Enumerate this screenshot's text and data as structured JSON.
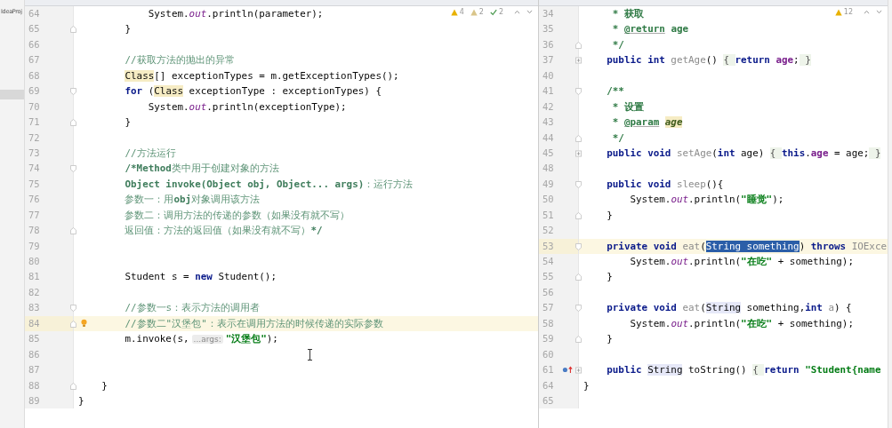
{
  "sidebar": {
    "label": "IdeaProj"
  },
  "panes": [
    {
      "inspections": [
        {
          "kind": "warning",
          "count": "4"
        },
        {
          "kind": "weak",
          "count": "2"
        },
        {
          "kind": "typo",
          "count": "2"
        }
      ],
      "lines": [
        {
          "number": "64",
          "current": false,
          "tokens": [
            {
              "t": "            System.",
              "kind": "plain"
            },
            {
              "t": "out",
              "kind": "field"
            },
            {
              "t": ".println(parameter);",
              "kind": "plain"
            }
          ]
        },
        {
          "number": "65",
          "current": false,
          "fold_end": true,
          "tokens": [
            {
              "t": "        }",
              "kind": "plain"
            }
          ]
        },
        {
          "number": "66",
          "current": false
        },
        {
          "number": "67",
          "current": false,
          "tokens": [
            {
              "t": "        //获取方法的抛出的异常",
              "kind": "cmt"
            }
          ]
        },
        {
          "number": "68",
          "current": false,
          "tokens": [
            {
              "t": "        Class",
              "kind": "hl"
            },
            {
              "t": "[] exceptionTypes = m.getExceptionTypes();",
              "kind": "plain"
            }
          ]
        },
        {
          "number": "69",
          "current": false,
          "fold_start": true,
          "tokens": [
            {
              "t": "        for",
              "kind": "kw"
            },
            {
              "t": " (",
              "kind": "plain"
            },
            {
              "t": "Class",
              "kind": "hl"
            },
            {
              "t": " exceptionType : exceptionTypes) {",
              "kind": "plain"
            }
          ]
        },
        {
          "number": "70",
          "current": false,
          "tokens": [
            {
              "t": "            System.",
              "kind": "plain"
            },
            {
              "t": "out",
              "kind": "field"
            },
            {
              "t": ".println(exceptionType);",
              "kind": "plain"
            }
          ]
        },
        {
          "number": "71",
          "current": false,
          "fold_end": true,
          "tokens": [
            {
              "t": "        }",
              "kind": "plain"
            }
          ]
        },
        {
          "number": "72",
          "current": false
        },
        {
          "number": "73",
          "current": false,
          "tokens": [
            {
              "t": "        //方法运行",
              "kind": "cmt"
            }
          ]
        },
        {
          "number": "74",
          "current": false,
          "fold_start": true,
          "tokens": [
            {
              "t": "        /*Method",
              "kind": "cmtb"
            },
            {
              "t": "类中用于创建对象的方法",
              "kind": "cmt"
            }
          ]
        },
        {
          "number": "75",
          "current": false,
          "tokens": [
            {
              "t": "        Object invoke(Object obj, Object... args)",
              "kind": "cmtb"
            },
            {
              "t": "：运行方法",
              "kind": "cmt"
            }
          ]
        },
        {
          "number": "76",
          "current": false,
          "tokens": [
            {
              "t": "        参数一：用",
              "kind": "cmt"
            },
            {
              "t": "obj",
              "kind": "cmtb"
            },
            {
              "t": "对象调用该方法",
              "kind": "cmt"
            }
          ]
        },
        {
          "number": "77",
          "current": false,
          "tokens": [
            {
              "t": "        参数二：调用方法的传递的参数（如果没有就不写）",
              "kind": "cmt"
            }
          ]
        },
        {
          "number": "78",
          "current": false,
          "fold_end": true,
          "tokens": [
            {
              "t": "        返回值：方法的返回值（如果没有就不写）",
              "kind": "cmt"
            },
            {
              "t": "*/",
              "kind": "cmtb"
            }
          ]
        },
        {
          "number": "79",
          "current": false
        },
        {
          "number": "80",
          "current": false
        },
        {
          "number": "81",
          "current": false,
          "tokens": [
            {
              "t": "        Student s = ",
              "kind": "plain"
            },
            {
              "t": "new",
              "kind": "kw"
            },
            {
              "t": " Student();",
              "kind": "plain"
            }
          ]
        },
        {
          "number": "82",
          "current": false
        },
        {
          "number": "83",
          "current": false,
          "fold_start": true,
          "tokens": [
            {
              "t": "        //参数一s：表示方法的调用者",
              "kind": "cmt"
            }
          ]
        },
        {
          "number": "84",
          "current": true,
          "fold_end": true,
          "bulb": true,
          "tokens": [
            {
              "t": "        //参数二\"汉堡包\"：表示在调用方法的时候传递的实际参数",
              "kind": "cmt"
            }
          ]
        },
        {
          "number": "85",
          "current": false,
          "tokens": [
            {
              "t": "        m.invoke(s,",
              "kind": "plain"
            },
            {
              "t": "...args:",
              "kind": "hint"
            },
            {
              "t": "\"汉堡包\"",
              "kind": "str"
            },
            {
              "t": ");",
              "kind": "plain"
            }
          ]
        },
        {
          "number": "86",
          "current": false
        },
        {
          "number": "87",
          "current": false
        },
        {
          "number": "88",
          "current": false,
          "fold_end": true,
          "tokens": [
            {
              "t": "    }",
              "kind": "plain"
            }
          ]
        },
        {
          "number": "89",
          "current": false,
          "tokens": [
            {
              "t": "}",
              "kind": "plain"
            }
          ]
        }
      ]
    },
    {
      "inspections": [
        {
          "kind": "warning",
          "count": "12"
        }
      ],
      "lines": [
        {
          "number": "34",
          "current": false,
          "tokens": [
            {
              "t": "     * 获取",
              "kind": "doc"
            }
          ]
        },
        {
          "number": "35",
          "current": false,
          "tokens": [
            {
              "t": "     * ",
              "kind": "doc"
            },
            {
              "t": "@return",
              "kind": "tag"
            },
            {
              "t": " age",
              "kind": "doc"
            }
          ]
        },
        {
          "number": "36",
          "current": false,
          "fold_end": true,
          "tokens": [
            {
              "t": "     */",
              "kind": "doc"
            }
          ]
        },
        {
          "number": "37",
          "current": false,
          "collapsed": true,
          "tokens": [
            {
              "t": "    public int ",
              "kind": "kw"
            },
            {
              "t": "getAge",
              "kind": "dim"
            },
            {
              "t": "() ",
              "kind": "plain"
            },
            {
              "t": "{ ",
              "kind": "folded"
            },
            {
              "t": "return ",
              "kind": "kw"
            },
            {
              "t": "age",
              "kind": "ivar"
            },
            {
              "t": ";",
              "kind": "plain"
            },
            {
              "t": " }",
              "kind": "folded"
            }
          ]
        },
        {
          "number": "40",
          "current": false
        },
        {
          "number": "41",
          "current": false,
          "fold_start": true,
          "tokens": [
            {
              "t": "    /**",
              "kind": "doc"
            }
          ]
        },
        {
          "number": "42",
          "current": false,
          "tokens": [
            {
              "t": "     * 设置",
              "kind": "doc"
            }
          ]
        },
        {
          "number": "43",
          "current": false,
          "tokens": [
            {
              "t": "     * ",
              "kind": "doc"
            },
            {
              "t": "@param",
              "kind": "tag"
            },
            {
              "t": "age",
              "kind": "param"
            }
          ]
        },
        {
          "number": "44",
          "current": false,
          "fold_end": true,
          "tokens": [
            {
              "t": "     */",
              "kind": "doc"
            }
          ]
        },
        {
          "number": "45",
          "current": false,
          "collapsed": true,
          "tokens": [
            {
              "t": "    public void ",
              "kind": "kw"
            },
            {
              "t": "setAge",
              "kind": "dim"
            },
            {
              "t": "(",
              "kind": "plain"
            },
            {
              "t": "int",
              "kind": "kw"
            },
            {
              "t": " age) ",
              "kind": "plain"
            },
            {
              "t": "{ ",
              "kind": "folded"
            },
            {
              "t": "this",
              "kind": "kw"
            },
            {
              "t": ".",
              "kind": "plain"
            },
            {
              "t": "age",
              "kind": "ivar"
            },
            {
              "t": " = age;",
              "kind": "plain"
            },
            {
              "t": " }",
              "kind": "folded"
            }
          ]
        },
        {
          "number": "48",
          "current": false
        },
        {
          "number": "49",
          "current": false,
          "fold_start": true,
          "tokens": [
            {
              "t": "    public void ",
              "kind": "kw"
            },
            {
              "t": "sleep",
              "kind": "dim"
            },
            {
              "t": "(){",
              "kind": "plain"
            }
          ]
        },
        {
          "number": "50",
          "current": false,
          "tokens": [
            {
              "t": "        System.",
              "kind": "plain"
            },
            {
              "t": "out",
              "kind": "field"
            },
            {
              "t": ".println(",
              "kind": "plain"
            },
            {
              "t": "\"睡觉\"",
              "kind": "str"
            },
            {
              "t": ");",
              "kind": "plain"
            }
          ]
        },
        {
          "number": "51",
          "current": false,
          "fold_end": true,
          "tokens": [
            {
              "t": "    }",
              "kind": "plain"
            }
          ]
        },
        {
          "number": "52",
          "current": false
        },
        {
          "number": "53",
          "current": true,
          "fold_start": true,
          "tokens": [
            {
              "t": "    private void ",
              "kind": "kw"
            },
            {
              "t": "eat",
              "kind": "dim"
            },
            {
              "t": "(",
              "kind": "plain"
            },
            {
              "t": "String something",
              "kind": "sel"
            },
            {
              "t": ") ",
              "kind": "plain"
            },
            {
              "t": "throws ",
              "kind": "kw"
            },
            {
              "t": "IOExce",
              "kind": "dim"
            }
          ]
        },
        {
          "number": "54",
          "current": false,
          "tokens": [
            {
              "t": "        System.",
              "kind": "plain"
            },
            {
              "t": "out",
              "kind": "field"
            },
            {
              "t": ".println(",
              "kind": "plain"
            },
            {
              "t": "\"在吃\"",
              "kind": "str"
            },
            {
              "t": " + something);",
              "kind": "plain"
            }
          ]
        },
        {
          "number": "55",
          "current": false,
          "fold_end": true,
          "tokens": [
            {
              "t": "    }",
              "kind": "plain"
            }
          ]
        },
        {
          "number": "56",
          "current": false
        },
        {
          "number": "57",
          "current": false,
          "fold_start": true,
          "tokens": [
            {
              "t": "    private void ",
              "kind": "kw"
            },
            {
              "t": "eat",
              "kind": "dim"
            },
            {
              "t": "(",
              "kind": "plain"
            },
            {
              "t": "String",
              "kind": "ref"
            },
            {
              "t": " something,",
              "kind": "plain"
            },
            {
              "t": "int ",
              "kind": "kw"
            },
            {
              "t": "a",
              "kind": "dim"
            },
            {
              "t": ") {",
              "kind": "plain"
            }
          ]
        },
        {
          "number": "58",
          "current": false,
          "tokens": [
            {
              "t": "        System.",
              "kind": "plain"
            },
            {
              "t": "out",
              "kind": "field"
            },
            {
              "t": ".println(",
              "kind": "plain"
            },
            {
              "t": "\"在吃\"",
              "kind": "str"
            },
            {
              "t": " + something);",
              "kind": "plain"
            }
          ]
        },
        {
          "number": "59",
          "current": false,
          "fold_end": true,
          "tokens": [
            {
              "t": "    }",
              "kind": "plain"
            }
          ]
        },
        {
          "number": "60",
          "current": false
        },
        {
          "number": "61",
          "current": false,
          "collapsed": true,
          "override": true,
          "tokens": [
            {
              "t": "    public ",
              "kind": "kw"
            },
            {
              "t": "String",
              "kind": "ref"
            },
            {
              "t": " toString() ",
              "kind": "plain"
            },
            {
              "t": "{ ",
              "kind": "folded"
            },
            {
              "t": "return ",
              "kind": "kw"
            },
            {
              "t": "\"Student{name",
              "kind": "str"
            }
          ]
        },
        {
          "number": "64",
          "current": false,
          "tokens": [
            {
              "t": "}",
              "kind": "plain"
            }
          ]
        },
        {
          "number": "65",
          "current": false
        }
      ]
    }
  ]
}
